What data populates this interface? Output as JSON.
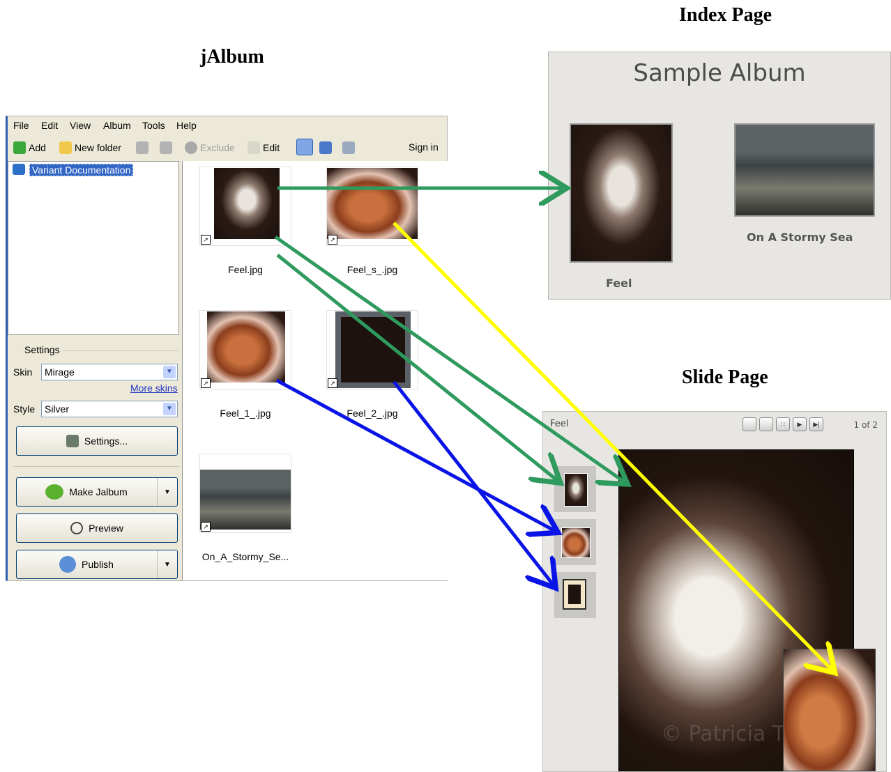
{
  "headings": {
    "jalbum": "jAlbum",
    "index_page": "Index Page",
    "slide_page": "Slide Page"
  },
  "app": {
    "menu": [
      "File",
      "Edit",
      "View",
      "Album",
      "Tools",
      "Help"
    ],
    "toolbar": {
      "add": "Add",
      "new_folder": "New folder",
      "exclude": "Exclude",
      "edit": "Edit",
      "sign_in": "Sign in"
    },
    "tree": {
      "root": "Variant Documentation"
    },
    "settings": {
      "group_label": "Settings",
      "skin_label": "Skin",
      "skin_value": "Mirage",
      "more_skins": "More skins",
      "style_label": "Style",
      "style_value": "Silver",
      "settings_button": "Settings..."
    },
    "actions": {
      "make": "Make Jalbum",
      "preview": "Preview",
      "publish": "Publish"
    },
    "files": [
      "Feel.jpg",
      "Feel_s_.jpg",
      "Feel_1_.jpg",
      "Feel_2_.jpg",
      "On_A_Stormy_Se..."
    ]
  },
  "index_page": {
    "title": "Sample Album",
    "items": [
      "Feel",
      "On A Stormy Sea"
    ]
  },
  "slide_page": {
    "title": "Feel",
    "counter": "1 of 2",
    "watermark": "© Patricia Tw"
  },
  "colors": {
    "arrow_green": "#2e9a5e",
    "arrow_yellow": "#ffff00",
    "arrow_blue": "#0a14e6",
    "selection": "#3166c5"
  },
  "icons": [
    "add-icon",
    "new-folder-icon",
    "back-icon",
    "forward-icon",
    "exclude-icon",
    "edit-icon",
    "thumbnail-view-icon",
    "image-view-icon",
    "slideshow-icon",
    "album-book-icon",
    "settings-icon",
    "frog-icon",
    "magnifier-icon",
    "globe-publish-icon"
  ]
}
